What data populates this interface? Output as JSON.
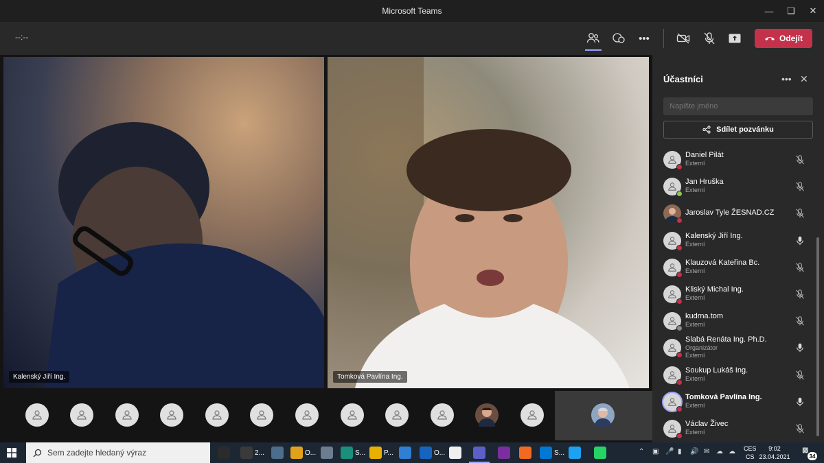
{
  "window": {
    "title": "Microsoft Teams"
  },
  "toolbar": {
    "timer": "--:--",
    "leave_label": "Odejít"
  },
  "videos": [
    {
      "name": "Kalenský Jiří Ing."
    },
    {
      "name": "Tomková Pavlína Ing."
    }
  ],
  "panel": {
    "title": "Účastníci",
    "search_placeholder": "Napište jméno",
    "share_label": "Sdílet pozvánku",
    "participants": [
      {
        "name": "Daniel Pilát",
        "sub": [
          "Externí"
        ],
        "status": "busy",
        "mic": "muted",
        "icon": "person-icon"
      },
      {
        "name": "Jan Hruška",
        "sub": [
          "Externí"
        ],
        "status": "available",
        "mic": "muted",
        "icon": "person-icon"
      },
      {
        "name": "Jaroslav Tyle ŽESNAD.CZ",
        "sub": [],
        "status": "busy",
        "mic": "muted",
        "icon": "photo-avatar"
      },
      {
        "name": "Kalenský Jiří Ing.",
        "sub": [
          "Externí"
        ],
        "status": "busy",
        "mic": "on",
        "icon": "person-icon"
      },
      {
        "name": "Klauzová Kateřina Bc.",
        "sub": [
          "Externí"
        ],
        "status": "busy",
        "mic": "muted",
        "icon": "person-icon"
      },
      {
        "name": "Kliský Michal Ing.",
        "sub": [
          "Externí"
        ],
        "status": "busy",
        "mic": "muted",
        "icon": "person-icon"
      },
      {
        "name": "kudrna.tom",
        "sub": [
          "Externí"
        ],
        "status": "unknown",
        "mic": "muted",
        "icon": "person-icon"
      },
      {
        "name": "Slabá Renáta Ing. Ph.D.",
        "sub": [
          "Organizátor",
          "Externí"
        ],
        "status": "busy",
        "mic": "on",
        "icon": "person-icon"
      },
      {
        "name": "Soukup Lukáš Ing.",
        "sub": [
          "Externí"
        ],
        "status": "busy",
        "mic": "muted",
        "icon": "person-icon"
      },
      {
        "name": "Tomková Pavlína Ing.",
        "sub": [
          "Externí"
        ],
        "status": "busy",
        "mic": "on",
        "icon": "person-icon",
        "selected": true
      },
      {
        "name": "Václav Živec",
        "sub": [
          "Externí"
        ],
        "status": "busy",
        "mic": "muted",
        "icon": "person-icon"
      }
    ]
  },
  "colors": {
    "busy": "#c4314b",
    "available": "#92c353",
    "unknown": "#8a8a8a",
    "accent": "#c4314b",
    "selected": "#9ea2ff"
  },
  "taskbar": {
    "search_placeholder": "Sem zadejte hledaný výraz",
    "apps": [
      {
        "icon": "task-view-icon",
        "label": ""
      },
      {
        "icon": "app-2-icon",
        "label": "2..."
      },
      {
        "icon": "calculator-icon",
        "label": ""
      },
      {
        "icon": "chrome-icon",
        "label": "O..."
      },
      {
        "icon": "app-icon",
        "label": ""
      },
      {
        "icon": "edge-icon",
        "label": "S..."
      },
      {
        "icon": "file-explorer-icon",
        "label": "P..."
      },
      {
        "icon": "mail-icon",
        "label": ""
      },
      {
        "icon": "outlook-icon",
        "label": "O..."
      },
      {
        "icon": "store-icon",
        "label": ""
      },
      {
        "icon": "teams-icon",
        "label": ""
      },
      {
        "icon": "onenote-icon",
        "label": ""
      },
      {
        "icon": "app-orange-icon",
        "label": ""
      },
      {
        "icon": "skype-icon",
        "label": "S..."
      },
      {
        "icon": "twitter-icon",
        "label": ""
      },
      {
        "icon": "whatsapp-icon",
        "label": ""
      }
    ],
    "lang_top": "CES",
    "lang_bottom": "CS",
    "time": "9:02",
    "date": "23.04.2021",
    "notifications": "34"
  }
}
